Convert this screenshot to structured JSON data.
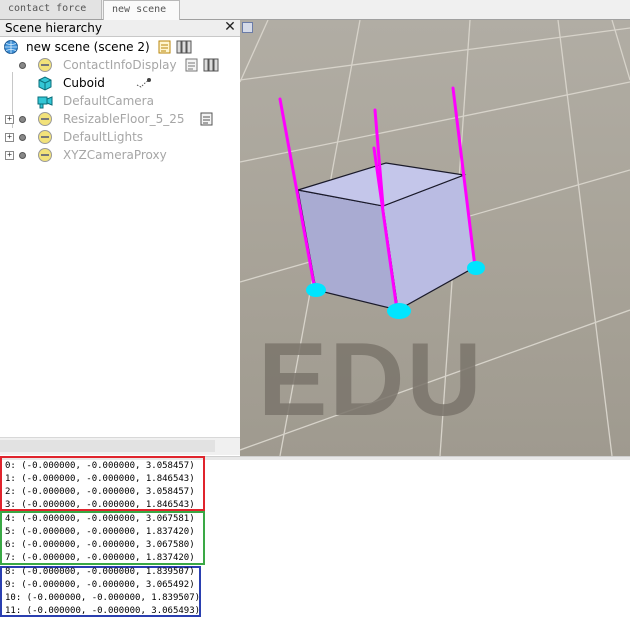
{
  "tabs": [
    {
      "label": "contact force",
      "active": false
    },
    {
      "label": "new scene",
      "active": true
    }
  ],
  "hierarchy": {
    "title": "Scene hierarchy",
    "close_glyph": "✕",
    "root": {
      "label": "new scene (scene 2)",
      "icon": "globe-icon"
    },
    "items": [
      {
        "label": "ContactInfoDisplay",
        "icon": "script-object-icon",
        "style": "gray",
        "expandable": false
      },
      {
        "label": "Cuboid",
        "icon": "cuboid-icon",
        "style": "black",
        "expandable": false
      },
      {
        "label": "DefaultCamera",
        "icon": "camera-icon",
        "style": "gray",
        "expandable": false
      },
      {
        "label": "ResizableFloor_5_25",
        "icon": "floor-object-icon",
        "style": "gray",
        "expandable": true
      },
      {
        "label": "DefaultLights",
        "icon": "lights-object-icon",
        "style": "gray",
        "expandable": true
      },
      {
        "label": "XYZCameraProxy",
        "icon": "proxy-object-icon",
        "style": "gray",
        "expandable": true
      }
    ]
  },
  "viewport": {
    "watermark": "EDU",
    "colors": {
      "force_vector": "#ff00ff",
      "contact_point": "#00e5ff",
      "cuboid": "#b7b9df"
    }
  },
  "console": {
    "groups": [
      {
        "color": "#e0242c",
        "lines": [
          "0: (-0.000000, -0.000000, 3.058457)",
          "1: (-0.000000, -0.000000, 1.846543)",
          "2: (-0.000000, -0.000000, 3.058457)",
          "3: (-0.000000, -0.000000, 1.846543)"
        ]
      },
      {
        "color": "#3aa845",
        "lines": [
          "4: (-0.000000, -0.000000, 3.067581)",
          "5: (-0.000000, -0.000000, 1.837420)",
          "6: (-0.000000, -0.000000, 3.067580)",
          "7: (-0.000000, -0.000000, 1.837420)"
        ]
      },
      {
        "color": "#2a3fb0",
        "lines": [
          "8: (-0.000000, -0.000000, 1.839507)",
          "9: (-0.000000, -0.000000, 3.065492)",
          "10: (-0.000000, -0.000000, 1.839507)",
          "11: (-0.000000, -0.000000, 3.065493)"
        ]
      }
    ]
  }
}
